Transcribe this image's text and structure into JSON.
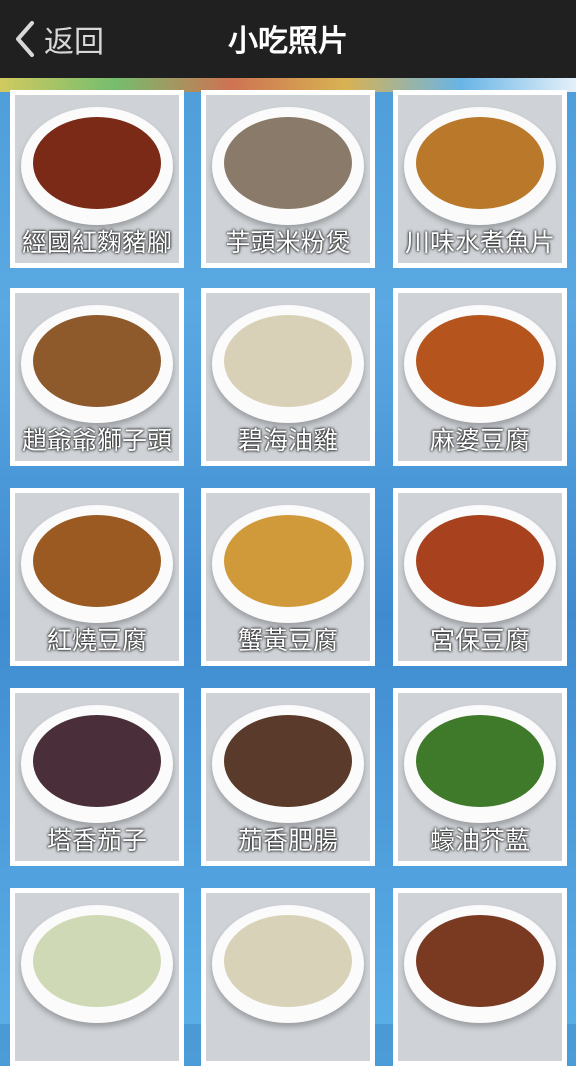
{
  "header": {
    "back_label": "返回",
    "title": "小吃照片"
  },
  "dishes": [
    {
      "label": "經國紅麴豬腳",
      "color": "#7a2a17"
    },
    {
      "label": "芋頭米粉煲",
      "color": "#8a7a6a"
    },
    {
      "label": "川味水煮魚片",
      "color": "#b9782a"
    },
    {
      "label": "趙爺爺獅子頭",
      "color": "#8e5a2c"
    },
    {
      "label": "碧海油雞",
      "color": "#d9d0b8"
    },
    {
      "label": "麻婆豆腐",
      "color": "#b5551d"
    },
    {
      "label": "紅燒豆腐",
      "color": "#9a5a22"
    },
    {
      "label": "蟹黃豆腐",
      "color": "#d09a3a"
    },
    {
      "label": "宮保豆腐",
      "color": "#a8421e"
    },
    {
      "label": "塔香茄子",
      "color": "#4a2f3a"
    },
    {
      "label": "茄香肥腸",
      "color": "#5a3a2a"
    },
    {
      "label": "蠔油芥藍",
      "color": "#3f7a2a"
    },
    {
      "label": "",
      "color": "#cfd9b5"
    },
    {
      "label": "",
      "color": "#d8d2b8"
    },
    {
      "label": "",
      "color": "#7a3a22"
    }
  ]
}
